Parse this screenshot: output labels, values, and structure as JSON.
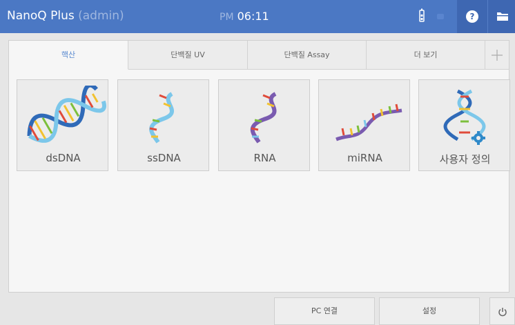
{
  "header": {
    "app_name": "NanoQ Plus",
    "user": "(admin)",
    "ampm": "PM",
    "time": "06:11",
    "brand_color": "#4b78c4"
  },
  "tabs": [
    {
      "label": "핵산",
      "active": true
    },
    {
      "label": "단백질 UV",
      "active": false
    },
    {
      "label": "단백질 Assay",
      "active": false
    },
    {
      "label": "더 보기",
      "active": false
    }
  ],
  "add_tab_icon": "plus-icon",
  "tiles": [
    {
      "label": "dsDNA",
      "icon": "dsdna-helix-icon"
    },
    {
      "label": "ssDNA",
      "icon": "ssdna-strand-icon"
    },
    {
      "label": "RNA",
      "icon": "rna-strand-icon"
    },
    {
      "label": "miRNA",
      "icon": "mirna-strand-icon"
    },
    {
      "label": "사용자 정의",
      "icon": "custom-helix-gear-icon"
    }
  ],
  "footer": {
    "pc_connect_label": "PC 연결",
    "settings_label": "설정",
    "power_icon": "power-icon"
  }
}
